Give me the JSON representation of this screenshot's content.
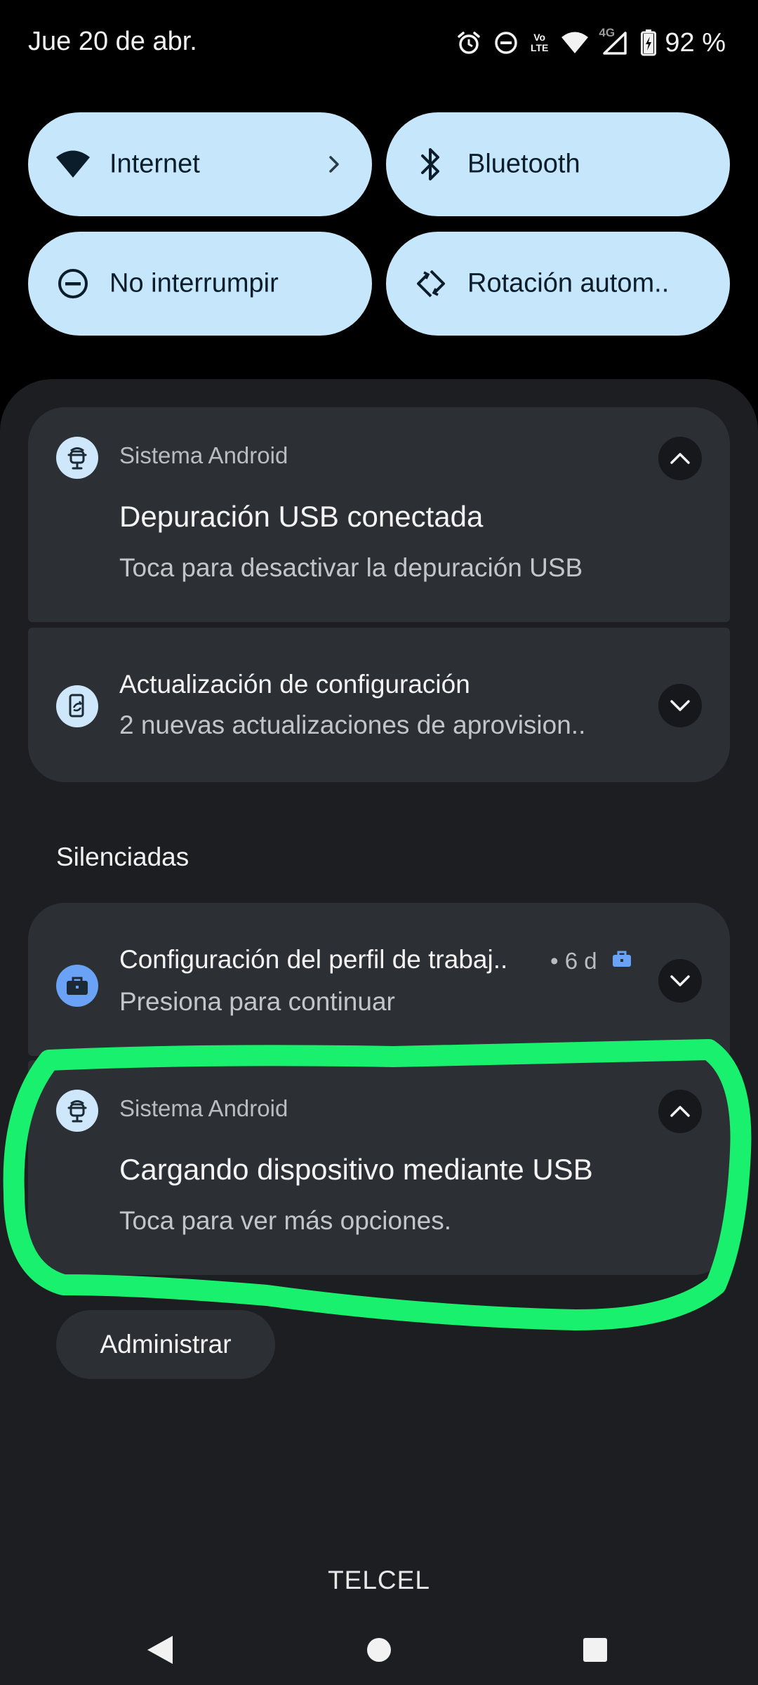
{
  "status_bar": {
    "date": "Jue 20 de abr.",
    "volte_top": "Vo",
    "volte_bottom": "LTE",
    "network_type": "4G",
    "battery": "92 %",
    "icons": [
      "alarm-icon",
      "dnd-icon",
      "volte-icon",
      "wifi-icon",
      "signal-icon",
      "battery-icon"
    ]
  },
  "quick_settings": [
    {
      "label": "Internet",
      "icon": "wifi-icon",
      "has_chevron": true
    },
    {
      "label": "Bluetooth",
      "icon": "bluetooth-icon"
    },
    {
      "label": "No interrumpir",
      "icon": "dnd-icon"
    },
    {
      "label": "Rotación autom..",
      "icon": "rotation-icon"
    }
  ],
  "notifications": {
    "usb_debug": {
      "app": "Sistema Android",
      "title": "Depuración USB conectada",
      "text": "Toca para desactivar la depuración USB",
      "expanded": true
    },
    "config_update": {
      "title": "Actualización de configuración",
      "text": "2 nuevas actualizaciones de aprovision..",
      "expanded": false
    },
    "silent_header": "Silenciadas",
    "work_profile": {
      "title": "Configuración del perfil de trabaj..",
      "time": "• 6 d",
      "text": "Presiona para continuar",
      "expanded": false
    },
    "usb_charging": {
      "app": "Sistema Android",
      "title": "Cargando dispositivo mediante USB",
      "text": "Toca para ver más opciones.",
      "expanded": true
    }
  },
  "manage_label": "Administrar",
  "carrier": "TELCEL",
  "colors": {
    "tile_bg": "#c6e6fb",
    "shade_bg": "#1c1e21",
    "card_bg": "#2c2f34",
    "highlight": "#19f06e",
    "work_badge": "#6aa3f5"
  }
}
